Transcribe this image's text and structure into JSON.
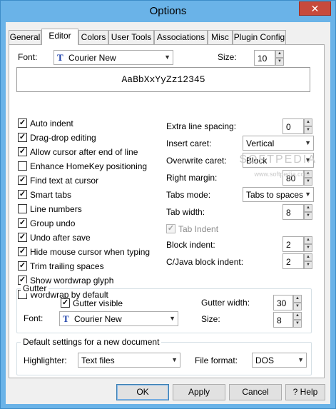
{
  "window": {
    "title": "Options",
    "close_glyph": "✕"
  },
  "tabs": [
    "General",
    "Editor",
    "Colors",
    "User Tools",
    "Associations",
    "Misc",
    "Plugin Config"
  ],
  "active_tab": "Editor",
  "font": {
    "label": "Font:",
    "value": "Courier New",
    "size_label": "Size:",
    "size": "10"
  },
  "preview_text": "AaBbXxYyZz12345",
  "checkboxes": [
    {
      "label": "Auto indent",
      "checked": true
    },
    {
      "label": "Drag-drop editing",
      "checked": true
    },
    {
      "label": "Allow cursor after end of line",
      "checked": true
    },
    {
      "label": "Enhance HomeKey positioning",
      "checked": false
    },
    {
      "label": "Find text at cursor",
      "checked": true
    },
    {
      "label": "Smart tabs",
      "checked": true
    },
    {
      "label": "Line numbers",
      "checked": false
    },
    {
      "label": "Group undo",
      "checked": true
    },
    {
      "label": "Undo after save",
      "checked": true
    },
    {
      "label": "Hide mouse cursor when typing",
      "checked": true
    },
    {
      "label": "Trim trailing spaces",
      "checked": true
    },
    {
      "label": "Show wordwrap glyph",
      "checked": true
    },
    {
      "label": "Wordwrap by default",
      "checked": false
    }
  ],
  "right": {
    "extra_line_spacing": {
      "label": "Extra line spacing:",
      "value": "0"
    },
    "insert_caret": {
      "label": "Insert caret:",
      "value": "Vertical"
    },
    "overwrite_caret": {
      "label": "Overwrite caret:",
      "value": "Block"
    },
    "right_margin": {
      "label": "Right margin:",
      "value": "80"
    },
    "tabs_mode": {
      "label": "Tabs mode:",
      "value": "Tabs to spaces"
    },
    "tab_width": {
      "label": "Tab width:",
      "value": "8"
    },
    "tab_indent": {
      "label": "Tab Indent",
      "checked": true
    },
    "block_indent": {
      "label": "Block indent:",
      "value": "2"
    },
    "cjava_indent": {
      "label": "C/Java block indent:",
      "value": "2"
    }
  },
  "gutter": {
    "title": "Gutter",
    "visible_label": "Gutter visible",
    "visible": true,
    "font_label": "Font:",
    "font_value": "Courier New",
    "width_label": "Gutter width:",
    "width": "30",
    "size_label": "Size:",
    "size": "8"
  },
  "defaults": {
    "title": "Default settings for a new document",
    "highlighter_label": "Highlighter:",
    "highlighter_value": "Text files",
    "format_label": "File format:",
    "format_value": "DOS"
  },
  "buttons": {
    "ok": "OK",
    "apply": "Apply",
    "cancel": "Cancel",
    "help_icon": "?",
    "help": "Help"
  },
  "watermark": {
    "brand": "SOFTPEDIA",
    "url": "www.softpedia.com"
  }
}
